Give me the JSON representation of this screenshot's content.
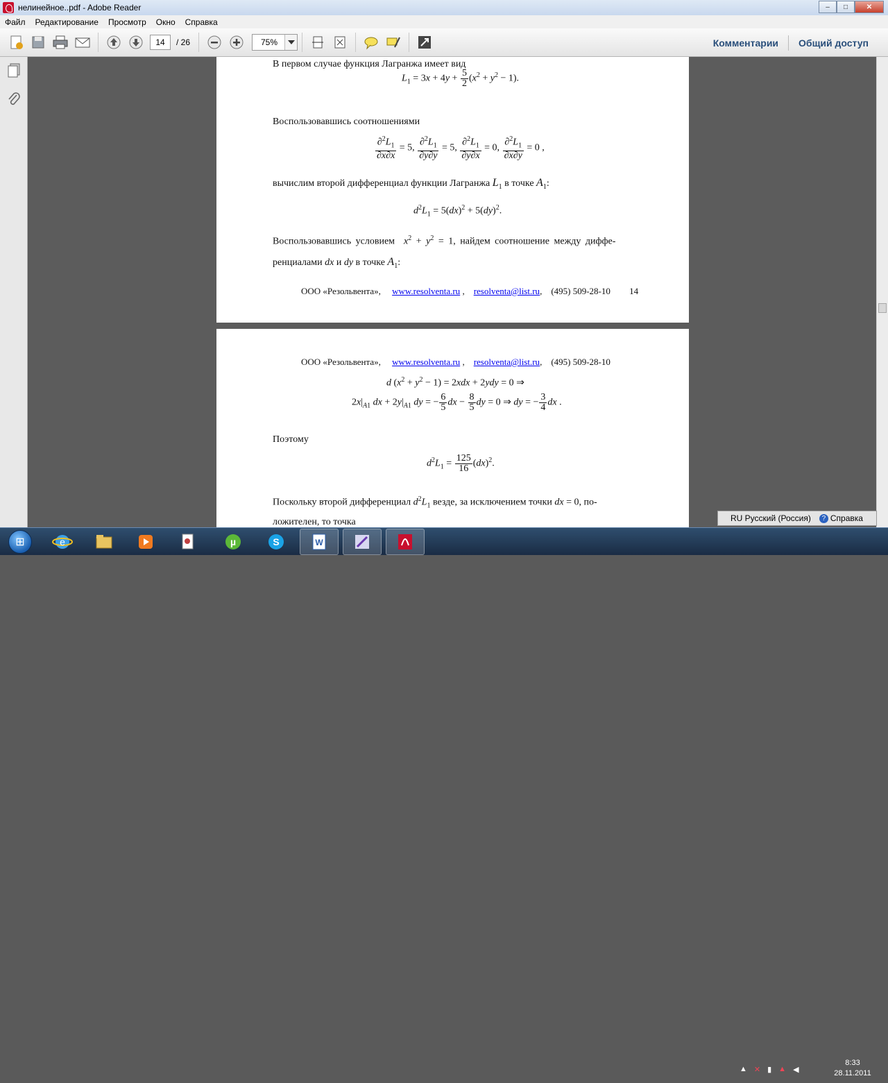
{
  "window": {
    "title": "нелинейное..pdf - Adobe Reader",
    "minimize": "‒",
    "maximize": "□",
    "close": "✕"
  },
  "menu": [
    "Файл",
    "Редактирование",
    "Просмотр",
    "Окно",
    "Справка"
  ],
  "toolbar": {
    "page_current": "14",
    "page_total": "/ 26",
    "zoom": "75%",
    "comments": "Комментарии",
    "share": "Общий доступ"
  },
  "page1": {
    "line1": "В первом случае функция Лагранжа имеет вид",
    "line2": "Воспользовавшись соотношениями",
    "line3": "вычислим второй дифференциал функции Лагранжа",
    "line3b": "в точке",
    "line4a": "Воспользовавшись условием",
    "line4b": ", найдем соотношение между диффе-",
    "line5a": "ренциалами",
    "line5b": "и",
    "line5c": "в точке",
    "footer_company": "ООО «Резольвента»,",
    "footer_site": "www.resolventa.ru",
    "footer_email": "resolventa@list.ru",
    "footer_phone": "(495) 509-28-10",
    "footer_page": "14"
  },
  "page2": {
    "footer_company": "ООО «Резольвента»,",
    "footer_site": "www.resolventa.ru",
    "footer_email": "resolventa@list.ru",
    "footer_phone": "(495) 509-28-10",
    "line1": "Поэтому",
    "line2a": "Поскольку второй дифференциал",
    "line2b": "везде, за исключением точки",
    "line2c": ", по-",
    "line3": "ложителен, то точка"
  },
  "langbar": {
    "lang": "RU Русский (Россия)",
    "help": "Справка"
  },
  "clock": {
    "time": "8:33",
    "date": "28.11.2011"
  }
}
